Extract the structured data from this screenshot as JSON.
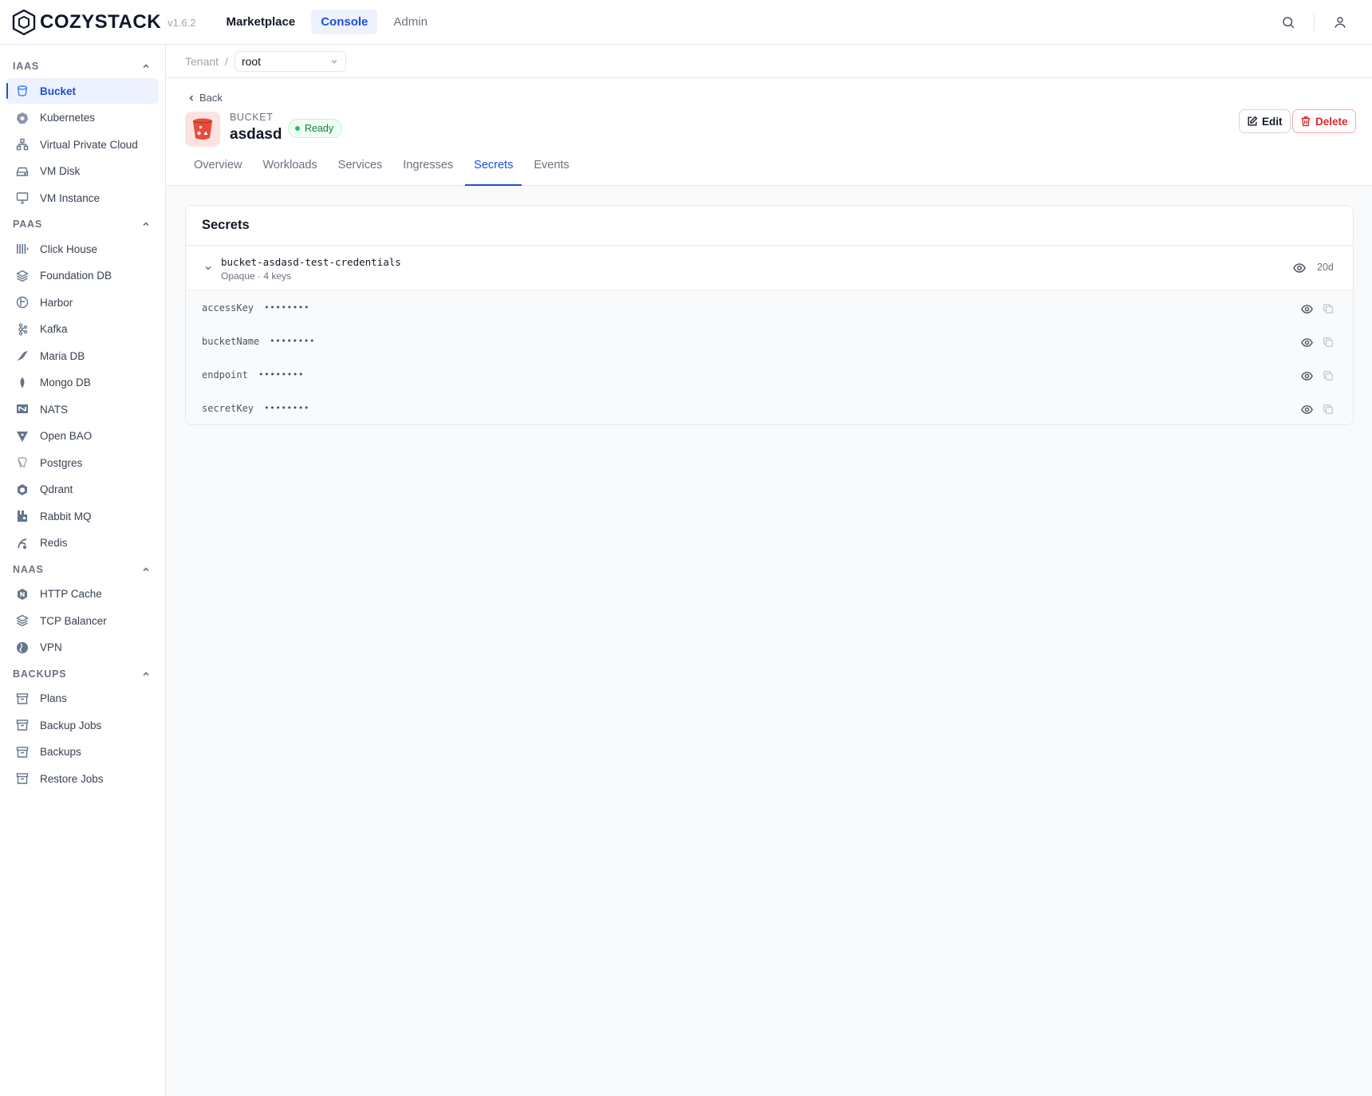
{
  "app": {
    "brand": "COZYSTACK",
    "version": "v1.6.2"
  },
  "topnav": [
    {
      "label": "Marketplace"
    },
    {
      "label": "Console"
    },
    {
      "label": "Admin"
    }
  ],
  "sidebar": {
    "sections": [
      {
        "title": "IAAS",
        "items": [
          {
            "label": "Bucket",
            "icon": "bucket-icon"
          },
          {
            "label": "Kubernetes",
            "icon": "kubernetes-icon"
          },
          {
            "label": "Virtual Private Cloud",
            "icon": "network-icon"
          },
          {
            "label": "VM Disk",
            "icon": "disk-icon"
          },
          {
            "label": "VM Instance",
            "icon": "monitor-icon"
          }
        ]
      },
      {
        "title": "PAAS",
        "items": [
          {
            "label": "Click House",
            "icon": "clickhouse-icon"
          },
          {
            "label": "Foundation DB",
            "icon": "layers-icon"
          },
          {
            "label": "Harbor",
            "icon": "harbor-icon"
          },
          {
            "label": "Kafka",
            "icon": "kafka-icon"
          },
          {
            "label": "Maria DB",
            "icon": "mariadb-icon"
          },
          {
            "label": "Mongo DB",
            "icon": "mongodb-icon"
          },
          {
            "label": "NATS",
            "icon": "nats-icon"
          },
          {
            "label": "Open BAO",
            "icon": "openbao-icon"
          },
          {
            "label": "Postgres",
            "icon": "postgres-icon"
          },
          {
            "label": "Qdrant",
            "icon": "qdrant-icon"
          },
          {
            "label": "Rabbit MQ",
            "icon": "rabbitmq-icon"
          },
          {
            "label": "Redis",
            "icon": "redis-icon"
          }
        ]
      },
      {
        "title": "NAAS",
        "items": [
          {
            "label": "HTTP Cache",
            "icon": "http-cache-icon"
          },
          {
            "label": "TCP Balancer",
            "icon": "layers-icon"
          },
          {
            "label": "VPN",
            "icon": "vpn-icon"
          }
        ]
      },
      {
        "title": "BACKUPS",
        "items": [
          {
            "label": "Plans",
            "icon": "archive-icon"
          },
          {
            "label": "Backup Jobs",
            "icon": "archive-icon"
          },
          {
            "label": "Backups",
            "icon": "archive-icon"
          },
          {
            "label": "Restore Jobs",
            "icon": "archive-icon"
          }
        ]
      }
    ]
  },
  "breadcrumb": {
    "label": "Tenant",
    "separator": "/",
    "selected": "root"
  },
  "resource": {
    "back_label": "Back",
    "kind": "BUCKET",
    "name": "asdasd",
    "status": "Ready",
    "edit_label": "Edit",
    "delete_label": "Delete"
  },
  "tabs": [
    {
      "label": "Overview"
    },
    {
      "label": "Workloads"
    },
    {
      "label": "Services"
    },
    {
      "label": "Ingresses"
    },
    {
      "label": "Secrets"
    },
    {
      "label": "Events"
    }
  ],
  "secrets_card": {
    "title": "Secrets",
    "secret": {
      "name": "bucket-asdasd-test-credentials",
      "meta": "Opaque · 4 keys",
      "age": "20d",
      "keys": [
        {
          "name": "accessKey",
          "masked": "••••••••"
        },
        {
          "name": "bucketName",
          "masked": "••••••••"
        },
        {
          "name": "endpoint",
          "masked": "••••••••"
        },
        {
          "name": "secretKey",
          "masked": "••••••••"
        }
      ]
    }
  },
  "colors": {
    "accent": "#1d4ed8",
    "danger": "#dc2626",
    "success": "#15803d"
  }
}
